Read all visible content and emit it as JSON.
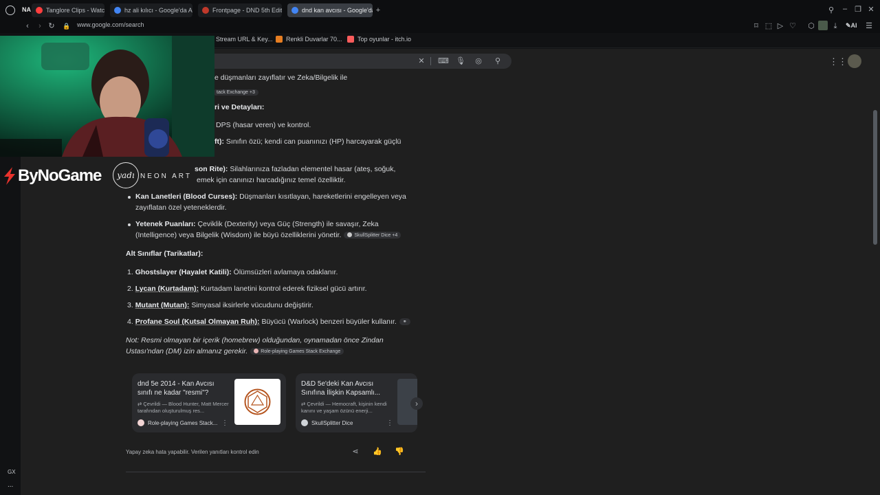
{
  "tabs": [
    {
      "label": "Tanglore Clips - Watch Liv",
      "color": "#ff3e3e",
      "active": false
    },
    {
      "label": "hz ali kılıcı - Google'da Ar",
      "color": "#4285f4",
      "active": false
    },
    {
      "label": "Frontpage - DND 5th Editi",
      "color": "#c0392b",
      "active": false
    },
    {
      "label": "dnd kan avcısı - Google'da",
      "color": "#4285f4",
      "active": true
    }
  ],
  "tab_badge": "NA",
  "url": "www.google.com/search",
  "bookmarks": [
    "Stream URL & Key...",
    "Renkli Duvarlar 70...",
    "Top oyunlar - itch.io"
  ],
  "ai_label": "AI",
  "content": {
    "line1": "e düşmanları zayıflatır ve Zeka/Bilgelik ile",
    "chip1": "tack Exchange +3",
    "heading1": "ri ve Detayları:",
    "line2": "DPS (hasar veren) ve kontrol.",
    "line3_bold": "ft):",
    "line3_rest": " Sınıfın özü; kendi can puanınızı (HP) harcayarak güçlü",
    "line4_bold": "son Rite):",
    "line4_rest": " Silahlarınıza fazladan elementel hasar (ateş, soğuk,",
    "line4b": "emek için canınızı harcadığınız temel özelliktir.",
    "bullet2_bold": "Kan Lanetleri (Blood Curses):",
    "bullet2_rest": " Düşmanları kısıtlayan, hareketlerini engelleyen veya",
    "bullet2b": "zayıflatan özel yeteneklerdir.",
    "bullet3_bold": "Yetenek Puanları:",
    "bullet3_rest": " Çeviklik (Dexterity) veya Güç (Strength) ile savaşır, Zeka",
    "bullet3b": "(Intelligence) veya Bilgelik (Wisdom) ile büyü özelliklerini yönetir.",
    "chip2": "SkullSplitter Dice +4",
    "heading2": "Alt Sınıflar (Tarikatlar):",
    "sub": [
      {
        "n": "1.",
        "bold": "Ghostslayer (Hayalet Katili):",
        "rest": " Ölümsüzleri avlamaya odaklanır."
      },
      {
        "n": "2.",
        "bold": "Lycan (Kurtadam):",
        "rest": " Kurtadam lanetini kontrol ederek fiziksel gücü artırır."
      },
      {
        "n": "3.",
        "bold": "Mutant (Mutan):",
        "rest": " Simyasal iksirlerle vücudunu değiştirir."
      },
      {
        "n": "4.",
        "bold": "Profane Soul (Kutsal Olmayan Ruh):",
        "rest": " Büyücü (Warlock) benzeri büyüler kullanır."
      }
    ],
    "note1": "Not: Resmi olmayan bir içerik (homebrew) olduğundan, oynamadan önce Zindan",
    "note2": "Ustası'ndan (DM) izin almanız gerekir.",
    "chip3": "Role-playing Games Stack Exchange",
    "disclaimer": "Yapay zeka hata yapabilir. Verilen yanıtları kontrol edin"
  },
  "cards": [
    {
      "title": "dnd 5e 2014 - Kan Avcısı sınıfı ne kadar \"resmi\"?",
      "snippet": "Çevrildi — Blood Hunter, Matt Mercer tarafından oluşturulmuş res...",
      "source": "Role-playing Games Stack..."
    },
    {
      "title": "D&D 5e'deki Kan Avcısı Sınıfına İlişkin Kapsamlı...",
      "snippet": "Çevrildi — Hemocraft, kişinin kendi kanını ve yaşam özünü enerji...",
      "source": "SkullSplitter Dice"
    }
  ],
  "overlay": {
    "brand": "ByNoGame",
    "neon": "NEON ART",
    "logo_text": "yadı"
  },
  "sidebar_bottom": "GX",
  "sidebar_more": "..."
}
